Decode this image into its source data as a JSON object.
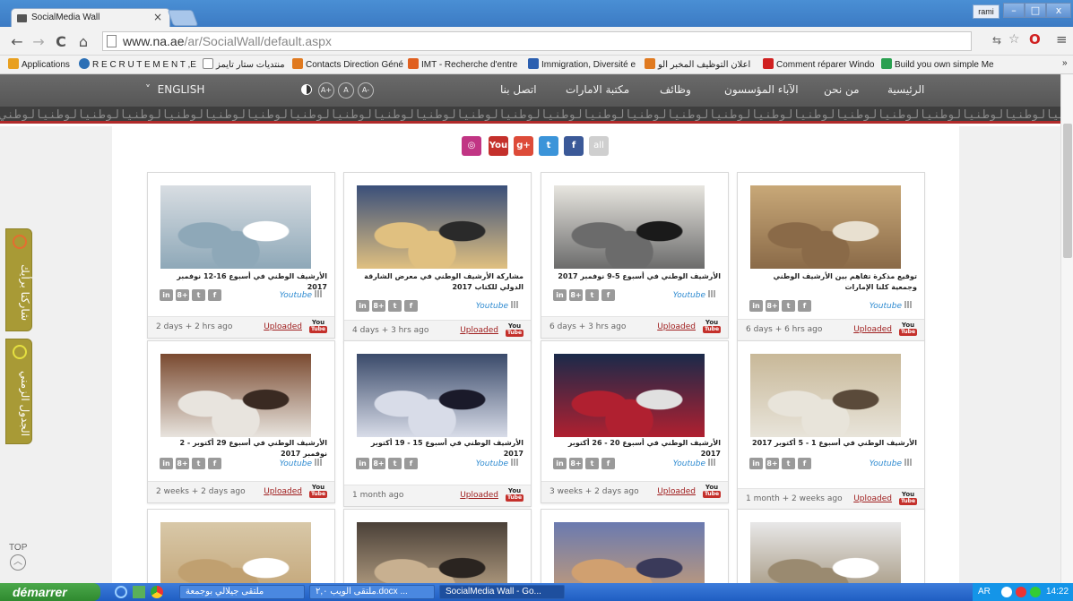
{
  "browser": {
    "tab_title": "SocialMedia Wall",
    "tab_close": "×",
    "user": "rami",
    "win_min": "–",
    "win_max": "□",
    "win_close": "x",
    "url_host": "www.na.ae",
    "url_path": "/ar/SocialWall/default.aspx",
    "bookmarks_overflow": "»"
  },
  "bookmarks": [
    {
      "label": "Applications",
      "color": "#e8a020"
    },
    {
      "label": "R E C R U T E M E N T ,E",
      "color": "#2b6fb5"
    },
    {
      "label": "منتديات ستار تايمز",
      "color": "#ffffff"
    },
    {
      "label": "Contacts Direction Géné",
      "color": "#e07a20"
    },
    {
      "label": "IMT - Recherche d'entre",
      "color": "#e06020"
    },
    {
      "label": "Immigration, Diversité e",
      "color": "#2b5fb0"
    },
    {
      "label": "اعلان التوظيف المخبر الو",
      "color": "#e07a20"
    },
    {
      "label": "Comment réparer Windo",
      "color": "#d02020"
    },
    {
      "label": "Build you own simple Me",
      "color": "#2aa050"
    }
  ],
  "site_nav": {
    "language": "ENGLISH",
    "font_plus": "A+",
    "font_normal": "A",
    "font_minus": "A-",
    "items": [
      "اتصل بنا",
      "مكتبة الامارات",
      "وظائف",
      "الآباء المؤسسون",
      "من نحن",
      "الرئيسية"
    ],
    "pattern": "الوطنيالوطنيالوطنيالوطنيالوطنيالوطنيالوطنيالوطنيالوطنيالوطنيالوطنيالوطنيالوطنيالوطنيالوطنيالوطنيالوطنيالوطنيالوطنيالوطنيالوطنيالوطنيالوطنيالوطنيالوطنيالوطني"
  },
  "social_filter": [
    {
      "name": "instagram",
      "label": "◎",
      "color": "#c13584"
    },
    {
      "name": "youtube",
      "label": "You",
      "color": "#c4302b"
    },
    {
      "name": "googleplus",
      "label": "g+",
      "color": "#dd4b39"
    },
    {
      "name": "twitter",
      "label": "t",
      "color": "#3b94d9"
    },
    {
      "name": "facebook",
      "label": "f",
      "color": "#3b5998"
    },
    {
      "name": "all",
      "label": "all",
      "color": "#cfcfcf"
    }
  ],
  "cards": [
    {
      "title": "الأرشيف الوطني في أسبوع 16-12 نوفمبر 2017",
      "time": "2 days + 2 hrs ago",
      "colors": [
        "#d8dde2",
        "#8ea8b8",
        "#ffffff"
      ]
    },
    {
      "title": "مشاركة الأرشيف الوطني في معرض الشارقة الدولي للكتاب 2017",
      "time": "4 days + 3 hrs ago",
      "colors": [
        "#3a4f7a",
        "#e0c080",
        "#2a2a2a"
      ]
    },
    {
      "title": "الأرشيف الوطني في أسبوع 5-9 نوفمبر 2017",
      "time": "6 days + 3 hrs ago",
      "colors": [
        "#e8e6e0",
        "#6b6b6b",
        "#1a1a1a"
      ]
    },
    {
      "title": "توقيع مذكرة تفاهم بين الأرشيف الوطني وجمعية كلنا الإمارات",
      "time": "6 days + 6 hrs ago",
      "colors": [
        "#c8a878",
        "#8a6a48",
        "#e8e0d0"
      ]
    },
    {
      "title": "الأرشيف الوطني في أسبوع 29 أكتوبر - 2 نوفمبر 2017",
      "time": "2 weeks + 2 days ago",
      "colors": [
        "#7a4a30",
        "#e8e4de",
        "#3a2a22"
      ]
    },
    {
      "title": "الأرشيف الوطني في أسبوع 15 - 19 أكتوبر 2017",
      "time": "1 month ago",
      "colors": [
        "#3a4a6a",
        "#d8dce8",
        "#1a1a2a"
      ]
    },
    {
      "title": "الأرشيف الوطني في أسبوع 20 - 26 أكتوبر 2017",
      "time": "3 weeks + 2 days ago",
      "colors": [
        "#1a2a4a",
        "#b02030",
        "#e0e0e0"
      ]
    },
    {
      "title": "الأرشيف الوطني في أسبوع 1 - 5 أكتوبر 2017",
      "time": "1 month + 2 weeks ago",
      "colors": [
        "#c8b898",
        "#e8e4da",
        "#5a4a3a"
      ]
    },
    {
      "title": "",
      "time": "",
      "colors": [
        "#d8c8a8",
        "#c0a070",
        "#ffffff"
      ]
    },
    {
      "title": "",
      "time": "",
      "colors": [
        "#4a4038",
        "#c8b090",
        "#2a2420"
      ]
    },
    {
      "title": "",
      "time": "",
      "colors": [
        "#6a7ab0",
        "#d0a070",
        "#3a3a5a"
      ]
    },
    {
      "title": "",
      "time": "",
      "colors": [
        "#e8e8e8",
        "#9a8a70",
        "#ffffff"
      ]
    }
  ],
  "card_common": {
    "source": "Youtube",
    "uploaded": "Uploaded",
    "yt_top": "You",
    "yt_bottom": "Tube",
    "share": [
      "in",
      "8+",
      "t",
      "f"
    ]
  },
  "side_tabs": {
    "share_opinion": "شاركنا برأيك",
    "schedule": "الجدول الزمني"
  },
  "top_label": "TOP",
  "taskbar": {
    "start": "démarrer",
    "tasks": [
      "ملتقى جيلالي بوجمعة",
      "ملتقى الويب ۲,۰.docx ...",
      "SocialMedia Wall - Go..."
    ],
    "lang": "AR",
    "clock": "14:22"
  }
}
